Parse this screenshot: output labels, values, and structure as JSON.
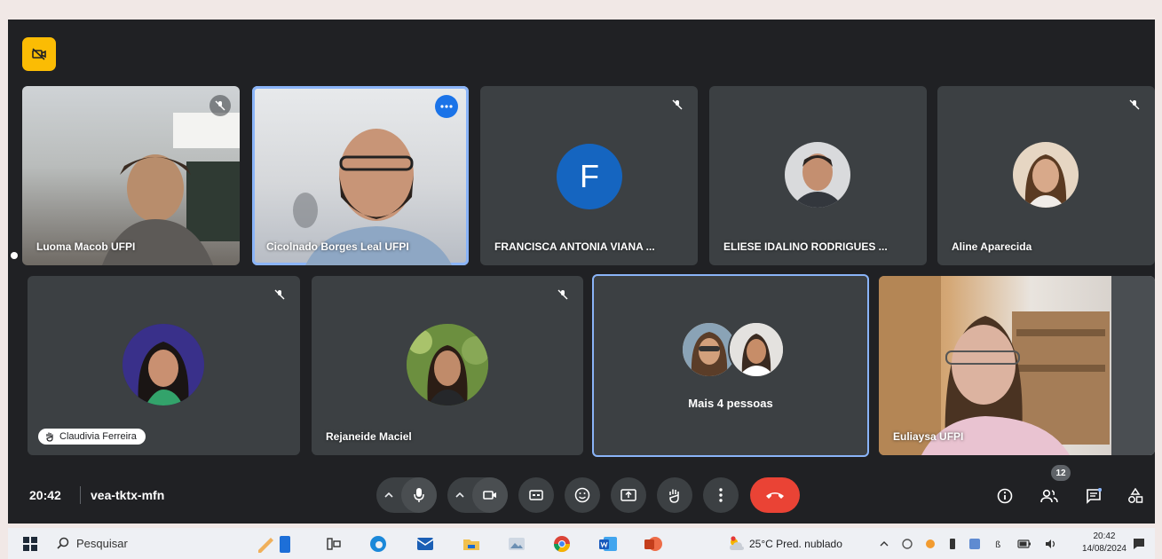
{
  "meeting": {
    "time": "20:42",
    "code": "vea-tktx-mfn",
    "participants_count": "12",
    "more_people_label": "Mais 4 pessoas"
  },
  "tiles": {
    "luoma": "Luoma Macob UFPI",
    "pinned": "Cicolnado Borges Leal UFPI",
    "francisca": "FRANCISCA ANTONIA VIANA ...",
    "francisca_initial": "F",
    "eliese": "ELIESE IDALINO RODRIGUES ...",
    "aline": "Aline Aparecida",
    "claudivia": "Claudivia Ferreira",
    "rejaneide": "Rejaneide Maciel",
    "euliaysa": "Euliaysa UFPI"
  },
  "taskbar": {
    "search_placeholder": "Pesquisar",
    "weather": "25°C  Pred. nublado",
    "clock_time": "20:42",
    "clock_date": "14/08/2024"
  },
  "colors": {
    "meet_bg": "#202124",
    "tile_bg": "#3c4043",
    "accent": "#8ab4f8",
    "end_call": "#ea4335",
    "badge": "#fbbc04"
  }
}
